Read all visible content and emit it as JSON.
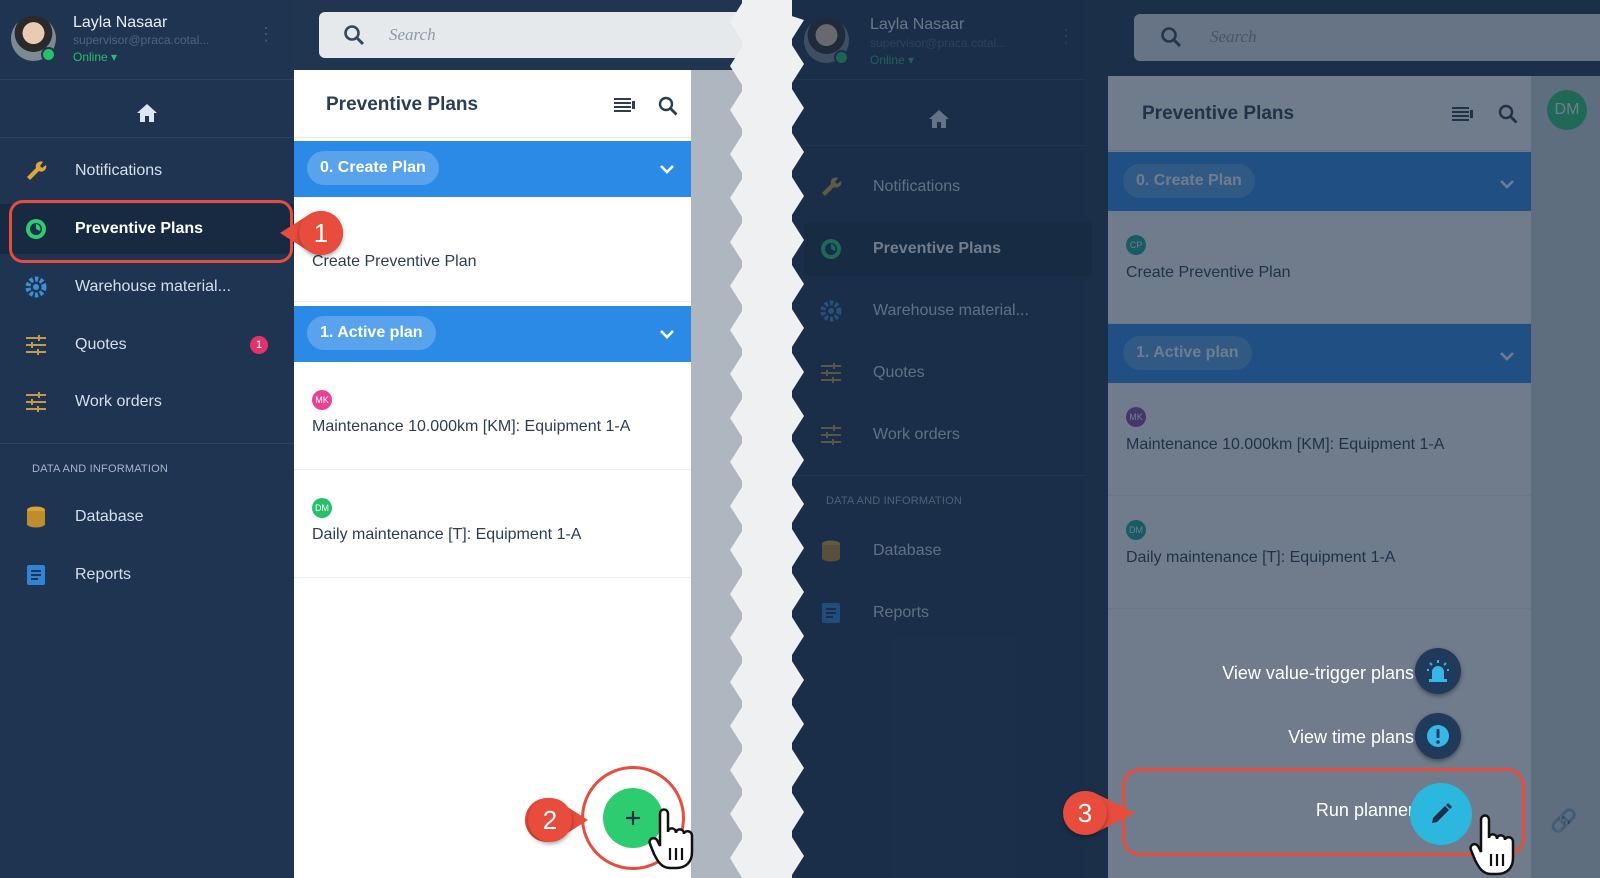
{
  "user": {
    "name": "Layla Nasaar",
    "email": "supervisor@praca.cotal...",
    "status": "Online"
  },
  "search": {
    "placeholder": "Search"
  },
  "sidebar": {
    "items": [
      {
        "label": "Notifications"
      },
      {
        "label": "Preventive Plans"
      },
      {
        "label": "Warehouse material..."
      },
      {
        "label": "Quotes",
        "badge": "1"
      },
      {
        "label": "Work orders"
      }
    ],
    "section_label": "DATA AND INFORMATION",
    "data_items": [
      {
        "label": "Database"
      },
      {
        "label": "Reports"
      }
    ]
  },
  "panel": {
    "title": "Preventive Plans",
    "groups": [
      {
        "label": "0. Create Plan",
        "rows": [
          {
            "initials": "CP",
            "title": "Create Preventive Plan"
          }
        ]
      },
      {
        "label": "1. Active plan",
        "rows": [
          {
            "initials": "MK",
            "title": "Maintenance 10.000km [KM]: Equipment 1-A"
          },
          {
            "initials": "DM",
            "title": "Daily maintenance [T]: Equipment 1-A"
          }
        ]
      }
    ]
  },
  "avatar_right": {
    "initials": "DM"
  },
  "actions": [
    {
      "label": "View value-trigger plans",
      "icon": "alarm-light-icon"
    },
    {
      "label": "View time plans",
      "icon": "exclamation-icon"
    },
    {
      "label": "Run planner",
      "icon": "pencil-icon"
    }
  ],
  "callouts": [
    "1",
    "2",
    "3"
  ],
  "colors": {
    "sidebar": "#1e3450",
    "accent_blue": "#2a8ae6",
    "fab_green": "#2ecc71",
    "fab_teal": "#2bb7de",
    "callout_red": "#e74c3c",
    "mk": "#e84393",
    "dm": "#27c06a",
    "cp": "#1aa99a"
  }
}
